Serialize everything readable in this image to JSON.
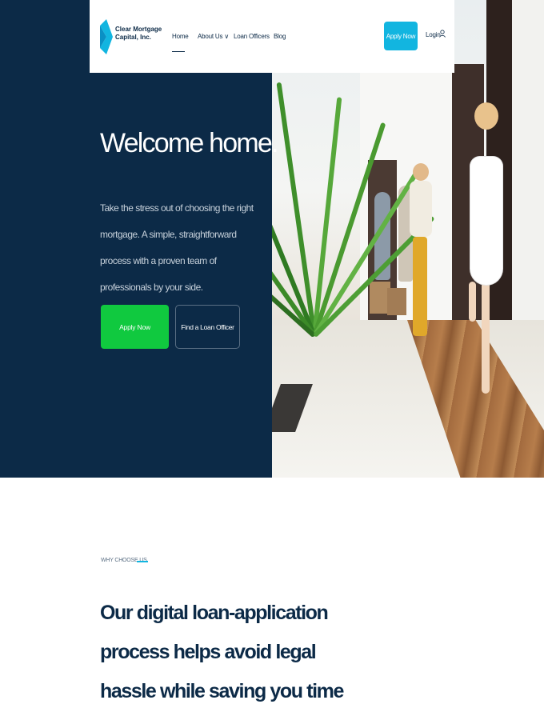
{
  "brand": {
    "name_line1": "Clear Mortgage",
    "name_line2": "Capital, Inc.",
    "logo_color": "#12b5e0"
  },
  "nav": {
    "items": [
      {
        "label": "Home",
        "active": true
      },
      {
        "label": "About Us ∨"
      },
      {
        "label": "Loan Officers"
      },
      {
        "label": "Blog"
      }
    ],
    "apply_label": "Apply Now",
    "login_label": "Login"
  },
  "hero": {
    "title": "Welcome home.",
    "subtitle": "Take the stress out of choosing the right mortgage. A simple, straightforward process with a proven team of professionals by your side.",
    "primary_cta": "Apply Now",
    "secondary_cta": "Find a Loan Officer"
  },
  "why": {
    "eyebrow": "WHY CHOOSE US",
    "heading": "Our digital loan-application process helps avoid legal hassle while saving you time and money."
  },
  "colors": {
    "navy": "#0c2a47",
    "accent_blue": "#12b5e0",
    "accent_green": "#10c93f"
  }
}
